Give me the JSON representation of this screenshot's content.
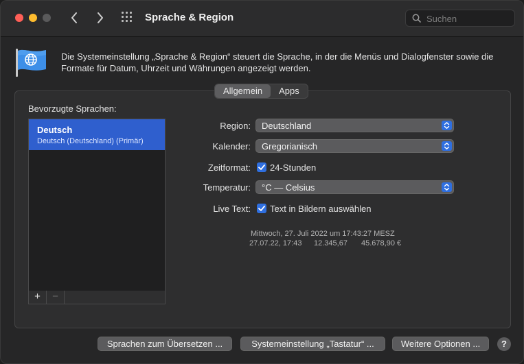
{
  "window": {
    "title": "Sprache & Region",
    "search_placeholder": "Suchen"
  },
  "header": {
    "description": "Die Systemeinstellung „Sprache & Region“ steuert die Sprache, in der die Menüs und Dialogfenster sowie die Formate für Datum, Uhrzeit und Währungen angezeigt werden."
  },
  "tabs": [
    {
      "label": "Allgemein",
      "active": true
    },
    {
      "label": "Apps",
      "active": false
    }
  ],
  "preferred_languages": {
    "label": "Bevorzugte Sprachen:",
    "items": [
      {
        "name": "Deutsch",
        "detail": "Deutsch (Deutschland) (Primär)"
      }
    ],
    "add_label": "+",
    "remove_label": "−"
  },
  "settings": {
    "region": {
      "label": "Region:",
      "value": "Deutschland"
    },
    "calendar": {
      "label": "Kalender:",
      "value": "Gregorianisch"
    },
    "time_format": {
      "label": "Zeitformat:",
      "checkbox_label": "24-Stunden",
      "checked": true
    },
    "temperature": {
      "label": "Temperatur:",
      "value": "°C — Celsius"
    },
    "live_text": {
      "label": "Live Text:",
      "checkbox_label": "Text in Bildern auswählen",
      "checked": true
    }
  },
  "sample": {
    "long_date": "Mittwoch, 27. Juli 2022 um 17:43:27 MESZ",
    "short_date": "27.07.22, 17:43",
    "number": "12.345,67",
    "currency": "45.678,90 €"
  },
  "buttons": {
    "translate": "Sprachen zum Übersetzen ...",
    "keyboard": "Systemeinstellung „Tastatur“ ...",
    "more_options": "Weitere Optionen ...",
    "help": "?"
  },
  "colors": {
    "accent": "#2f6fe0",
    "selection": "#2f5fce"
  }
}
